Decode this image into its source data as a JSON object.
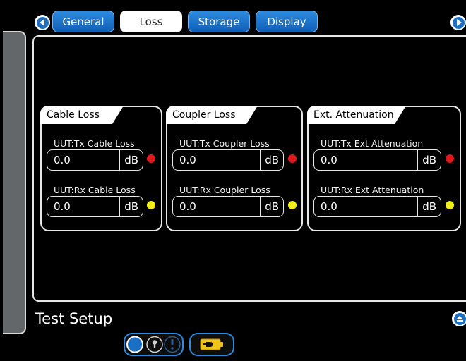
{
  "header": {
    "tabs": [
      {
        "label": "General",
        "active": false
      },
      {
        "label": "Loss",
        "active": true
      },
      {
        "label": "Storage",
        "active": false
      },
      {
        "label": "Display",
        "active": false
      }
    ]
  },
  "groups": [
    {
      "title": "Cable Loss",
      "fields": [
        {
          "label": "UUT:Tx Cable Loss",
          "value": "0.0",
          "unit": "dB",
          "indicator": "#e0191d"
        },
        {
          "label": "UUT:Rx Cable Loss",
          "value": "0.0",
          "unit": "dB",
          "indicator": "#f1ee1b"
        }
      ]
    },
    {
      "title": "Coupler Loss",
      "fields": [
        {
          "label": "UUT:Tx Coupler Loss",
          "value": "0.0",
          "unit": "dB",
          "indicator": "#e0191d"
        },
        {
          "label": "UUT:Rx Coupler Loss",
          "value": "0.0",
          "unit": "dB",
          "indicator": "#f1ee1b"
        }
      ]
    },
    {
      "title": "Ext. Attenuation",
      "fields": [
        {
          "label": "UUT:Tx Ext Attenuation",
          "value": "0.0",
          "unit": "dB",
          "indicator": "#e0191d"
        },
        {
          "label": "UUT:Rx Ext Attenuation",
          "value": "0.0",
          "unit": "dB",
          "indicator": "#f1ee1b"
        }
      ]
    }
  ],
  "footer": {
    "title": "Test Setup"
  },
  "icons": {
    "prev": "arrow-left-icon",
    "next": "arrow-right-icon",
    "scroll": "collapse-up-icon",
    "status": [
      "circle-status-icon",
      "key-icon",
      "alert-icon"
    ],
    "battery": "battery-plug-icon"
  },
  "colors": {
    "accent": "#1b6fc4",
    "red": "#e0191d",
    "yellow": "#f1ee1b"
  }
}
